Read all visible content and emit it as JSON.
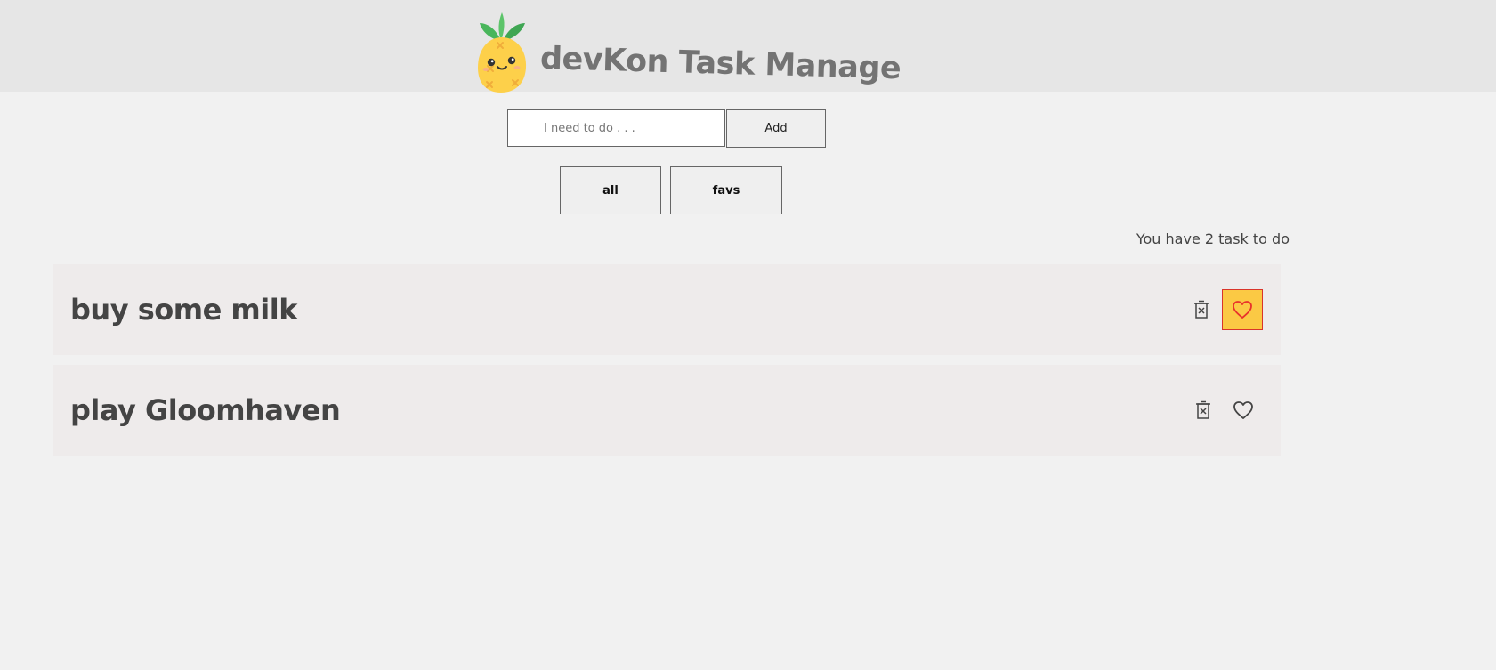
{
  "header": {
    "title": "devKon Task Manage",
    "logo_icon": "pineapple-logo-icon"
  },
  "form": {
    "input_placeholder": "I need to do . . .",
    "input_value": "",
    "add_label": "Add"
  },
  "filters": {
    "all_label": "all",
    "favs_label": "favs"
  },
  "status": {
    "count_text": "You have 2 task to do"
  },
  "tasks": [
    {
      "title": "buy some milk",
      "favorite": true
    },
    {
      "title": "play Gloomhaven",
      "favorite": false
    }
  ],
  "colors": {
    "accent": "#fbc944",
    "heart_active": "#e8322b",
    "header_bg": "#e6e6e6",
    "page_bg": "#f1f1f1",
    "row_bg": "#eeebeb"
  }
}
